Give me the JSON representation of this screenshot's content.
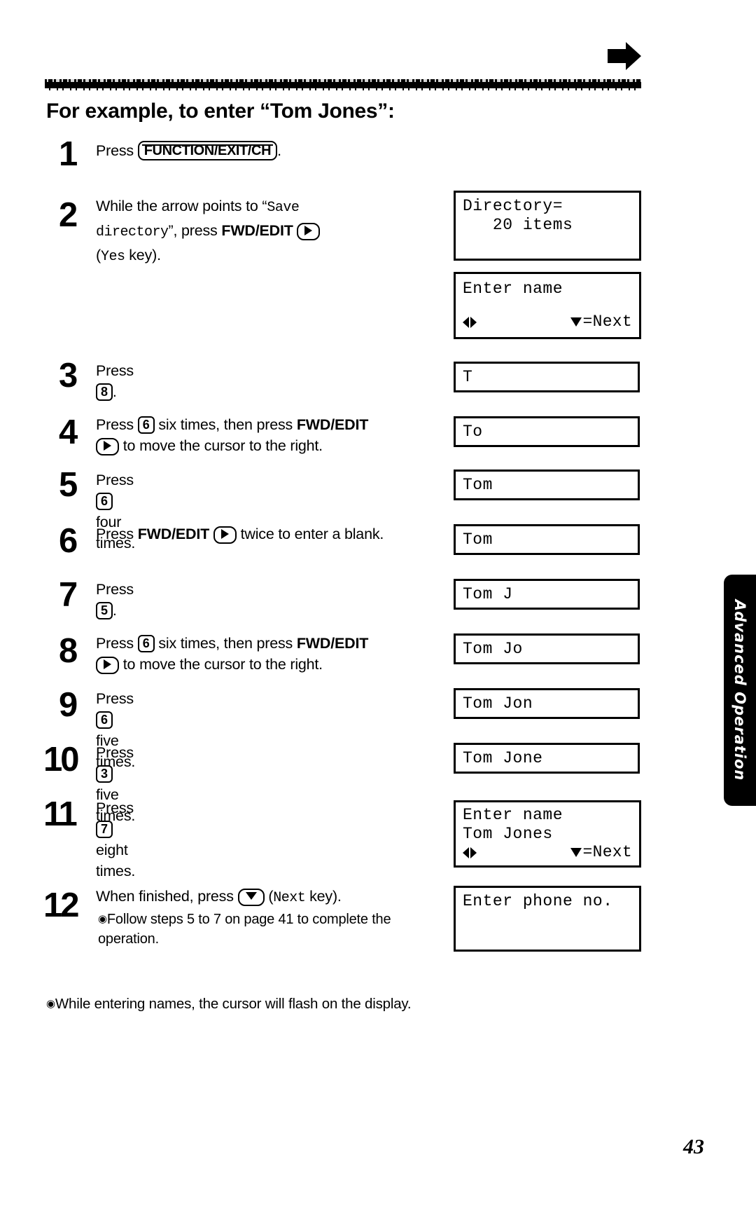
{
  "header": {
    "arrow_icon": "right-arrow-icon"
  },
  "title": "For example, to enter “Tom Jones”:",
  "steps": [
    {
      "num": "1",
      "pre": "Press ",
      "key": "FUNCTION/EXIT/CH",
      "post": "."
    },
    {
      "num": "2",
      "line1_a": "While the arrow points to “",
      "line1_mono": "Save",
      "line2_mono": "directory",
      "line2_a": "”, press ",
      "line2_bold": "FWD/EDIT",
      "line3_mono": "Yes",
      "line3_b": " key)."
    },
    {
      "num": "3",
      "pre": "Press ",
      "key": "8",
      "post": "."
    },
    {
      "num": "4",
      "pre": "Press ",
      "key": "6",
      "mid": " six times, then press ",
      "bold": "FWD/EDIT",
      "post": " to move the cursor to the right."
    },
    {
      "num": "5",
      "pre": "Press ",
      "key": "6",
      "post": " four times."
    },
    {
      "num": "6",
      "pre": "Press ",
      "bold": "FWD/EDIT",
      "post": " twice to enter a blank."
    },
    {
      "num": "7",
      "pre": "Press ",
      "key": "5",
      "post": "."
    },
    {
      "num": "8",
      "pre": "Press ",
      "key": "6",
      "mid": " six times, then press ",
      "bold": "FWD/EDIT",
      "post": " to move the cursor to the right."
    },
    {
      "num": "9",
      "pre": "Press ",
      "key": "6",
      "post": " five times."
    },
    {
      "num": "10",
      "pre": "Press ",
      "key": "3",
      "post": " five times."
    },
    {
      "num": "11",
      "pre": "Press ",
      "key": "7",
      "post": " eight times."
    },
    {
      "num": "12",
      "pre": "When finished, press ",
      "mono": "Next",
      "post": " key).",
      "sub": "Follow steps 5 to 7 on page 41 to complete the operation."
    }
  ],
  "displays": {
    "d1_line1": "Directory=",
    "d1_line2": "   20 items",
    "d2_line1": "Enter name",
    "d2_next": "=Next",
    "d3": "T",
    "d4": "To",
    "d5": "Tom",
    "d6": "Tom",
    "d7": "Tom J",
    "d8": "Tom Jo",
    "d9": "Tom Jon",
    "d10": "Tom Jone",
    "d11_line1": "Enter name",
    "d11_line2": "Tom Jones",
    "d11_next": "=Next",
    "d12": "Enter phone no."
  },
  "sidetab": "Advanced Operation",
  "footnote": "While entering names, the cursor will flash on the display.",
  "page_number": "43"
}
